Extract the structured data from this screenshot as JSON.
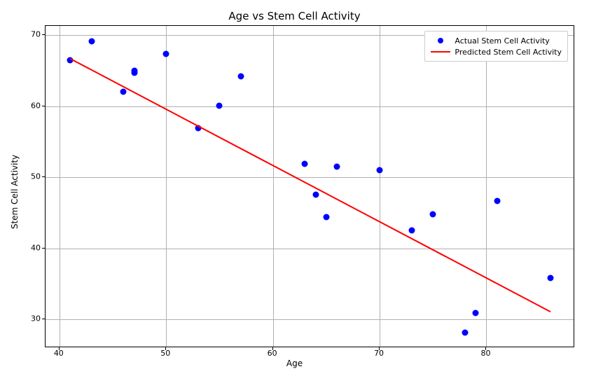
{
  "chart_data": {
    "type": "scatter",
    "title": "Age vs Stem Cell Activity",
    "xlabel": "Age",
    "ylabel": "Stem Cell Activity",
    "xlim": [
      38.7,
      88.3
    ],
    "ylim": [
      26.0,
      71.3
    ],
    "xticks": [
      40,
      50,
      60,
      70,
      80
    ],
    "yticks": [
      30,
      40,
      50,
      60,
      70
    ],
    "series": [
      {
        "name": "Actual Stem Cell Activity",
        "render": "scatter",
        "color": "#0000ff",
        "points": [
          {
            "x": 41,
            "y": 66.5
          },
          {
            "x": 43,
            "y": 69.1
          },
          {
            "x": 46,
            "y": 62.0
          },
          {
            "x": 47,
            "y": 65.0
          },
          {
            "x": 47,
            "y": 64.7
          },
          {
            "x": 50,
            "y": 67.4
          },
          {
            "x": 53,
            "y": 56.9
          },
          {
            "x": 55,
            "y": 60.1
          },
          {
            "x": 57,
            "y": 64.2
          },
          {
            "x": 63,
            "y": 51.9
          },
          {
            "x": 64,
            "y": 47.6
          },
          {
            "x": 65,
            "y": 44.4
          },
          {
            "x": 66,
            "y": 51.5
          },
          {
            "x": 70,
            "y": 51.0
          },
          {
            "x": 73,
            "y": 42.5
          },
          {
            "x": 75,
            "y": 44.8
          },
          {
            "x": 78,
            "y": 28.2
          },
          {
            "x": 79,
            "y": 30.9
          },
          {
            "x": 81,
            "y": 46.7
          },
          {
            "x": 86,
            "y": 35.8
          }
        ]
      },
      {
        "name": "Predicted Stem Cell Activity",
        "render": "line",
        "color": "#ff0000",
        "linewidth": 2,
        "line": {
          "x1": 41,
          "y1": 66.7,
          "x2": 86,
          "y2": 31.1
        }
      }
    ],
    "legend": {
      "position": "upper right",
      "frame": true
    }
  }
}
